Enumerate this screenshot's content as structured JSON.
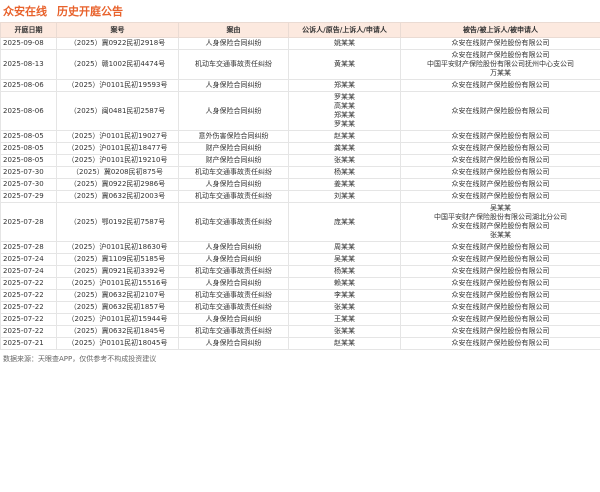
{
  "header": {
    "brand": "众安在线",
    "title": "历史开庭公告"
  },
  "columns": [
    "开庭日期",
    "案号",
    "案由",
    "公诉人/原告/上诉人/申请人",
    "被告/被上诉人/被申请人"
  ],
  "rows": [
    {
      "date": "2025-09-08",
      "case_no": "（2025）冀0922民初2918号",
      "cause": "人身保险合同纠纷",
      "plaintiffs": [
        "姚某某"
      ],
      "defendants": [
        "众安在线财产保险股份有限公司"
      ]
    },
    {
      "date": "2025-08-13",
      "case_no": "（2025）赣1002民初4474号",
      "cause": "机动车交通事故责任纠纷",
      "plaintiffs": [
        "黄某某"
      ],
      "defendants": [
        "众安在线财产保险股份有限公司",
        "中国平安财产保险股份有限公司抚州中心支公司",
        "万某某"
      ]
    },
    {
      "date": "2025-08-06",
      "case_no": "（2025）沪0101民初19593号",
      "cause": "人身保险合同纠纷",
      "plaintiffs": [
        "郑某某"
      ],
      "defendants": [
        "众安在线财产保险股份有限公司"
      ]
    },
    {
      "date": "2025-08-06",
      "case_no": "（2025）闽0481民初2587号",
      "cause": "人身保险合同纠纷",
      "plaintiffs": [
        "罗某某",
        "高某某",
        "郑某某",
        "罗某某"
      ],
      "defendants": [
        "众安在线财产保险股份有限公司"
      ]
    },
    {
      "date": "2025-08-05",
      "case_no": "（2025）沪0101民初19027号",
      "cause": "意外伤害保险合同纠纷",
      "plaintiffs": [
        "赵某某"
      ],
      "defendants": [
        "众安在线财产保险股份有限公司"
      ]
    },
    {
      "date": "2025-08-05",
      "case_no": "（2025）沪0101民初18477号",
      "cause": "财产保险合同纠纷",
      "plaintiffs": [
        "龚某某"
      ],
      "defendants": [
        "众安在线财产保险股份有限公司"
      ]
    },
    {
      "date": "2025-08-05",
      "case_no": "（2025）沪0101民初19210号",
      "cause": "财产保险合同纠纷",
      "plaintiffs": [
        "张某某"
      ],
      "defendants": [
        "众安在线财产保险股份有限公司"
      ]
    },
    {
      "date": "2025-07-30",
      "case_no": "（2025）冀0208民初875号",
      "cause": "机动车交通事故责任纠纷",
      "plaintiffs": [
        "杨某某"
      ],
      "defendants": [
        "众安在线财产保险股份有限公司"
      ]
    },
    {
      "date": "2025-07-30",
      "case_no": "（2025）冀0922民初2986号",
      "cause": "人身保险合同纠纷",
      "plaintiffs": [
        "姜某某"
      ],
      "defendants": [
        "众安在线财产保险股份有限公司"
      ]
    },
    {
      "date": "2025-07-29",
      "case_no": "（2025）冀0632民初2003号",
      "cause": "机动车交通事故责任纠纷",
      "plaintiffs": [
        "刘某某"
      ],
      "defendants": [
        "众安在线财产保险股份有限公司"
      ]
    },
    {
      "date": "2025-07-28",
      "case_no": "（2025）鄂0192民初7587号",
      "cause": "机动车交通事故责任纠纷",
      "plaintiffs": [
        "庞某某"
      ],
      "defendants": [
        "吴某某",
        "中国平安财产保险股份有限公司湖北分公司",
        "众安在线财产保险股份有限公司",
        "张某某"
      ]
    },
    {
      "date": "2025-07-28",
      "case_no": "（2025）沪0101民初18630号",
      "cause": "人身保险合同纠纷",
      "plaintiffs": [
        "周某某"
      ],
      "defendants": [
        "众安在线财产保险股份有限公司"
      ]
    },
    {
      "date": "2025-07-24",
      "case_no": "（2025）冀1109民初5185号",
      "cause": "人身保险合同纠纷",
      "plaintiffs": [
        "吴某某"
      ],
      "defendants": [
        "众安在线财产保险股份有限公司"
      ]
    },
    {
      "date": "2025-07-24",
      "case_no": "（2025）冀0921民初3392号",
      "cause": "机动车交通事故责任纠纷",
      "plaintiffs": [
        "杨某某"
      ],
      "defendants": [
        "众安在线财产保险股份有限公司"
      ]
    },
    {
      "date": "2025-07-22",
      "case_no": "（2025）沪0101民初15516号",
      "cause": "人身保险合同纠纷",
      "plaintiffs": [
        "赖某某"
      ],
      "defendants": [
        "众安在线财产保险股份有限公司"
      ]
    },
    {
      "date": "2025-07-22",
      "case_no": "（2025）冀0632民初2107号",
      "cause": "机动车交通事故责任纠纷",
      "plaintiffs": [
        "李某某"
      ],
      "defendants": [
        "众安在线财产保险股份有限公司"
      ]
    },
    {
      "date": "2025-07-22",
      "case_no": "（2025）冀0632民初1857号",
      "cause": "机动车交通事故责任纠纷",
      "plaintiffs": [
        "张某某"
      ],
      "defendants": [
        "众安在线财产保险股份有限公司"
      ]
    },
    {
      "date": "2025-07-22",
      "case_no": "（2025）沪0101民初15944号",
      "cause": "人身保险合同纠纷",
      "plaintiffs": [
        "王某某"
      ],
      "defendants": [
        "众安在线财产保险股份有限公司"
      ]
    },
    {
      "date": "2025-07-22",
      "case_no": "（2025）冀0632民初1845号",
      "cause": "机动车交通事故责任纠纷",
      "plaintiffs": [
        "张某某"
      ],
      "defendants": [
        "众安在线财产保险股份有限公司"
      ]
    },
    {
      "date": "2025-07-21",
      "case_no": "（2025）沪0101民初18045号",
      "cause": "人身保险合同纠纷",
      "plaintiffs": [
        "赵某某"
      ],
      "defendants": [
        "众安在线财产保险股份有限公司"
      ]
    }
  ],
  "footer": {
    "source": "数据来源：天眼查APP，仅供参考不构成投资建议"
  }
}
